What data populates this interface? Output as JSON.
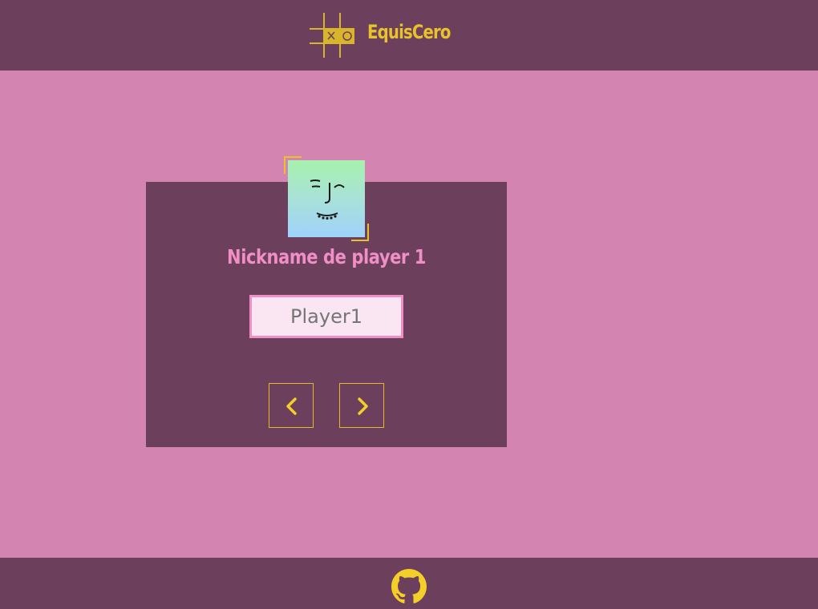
{
  "header": {
    "app_title": "EquisCero",
    "logo_icon": "tic-tac-toe-icon"
  },
  "player_card": {
    "avatar_icon": "smiling-face-avatar-icon",
    "nickname_label": "Nickname de player 1",
    "nickname_input": {
      "value": "",
      "placeholder": "Player1"
    },
    "prev_icon": "chevron-left-icon",
    "next_icon": "chevron-right-icon"
  },
  "footer": {
    "github_icon": "github-icon"
  },
  "colors": {
    "background": "#d384b0",
    "panel": "#6c3f5c",
    "accent_yellow": "#e7c22a",
    "accent_pink": "#f08ec6",
    "input_bg": "#f9e6f2"
  }
}
